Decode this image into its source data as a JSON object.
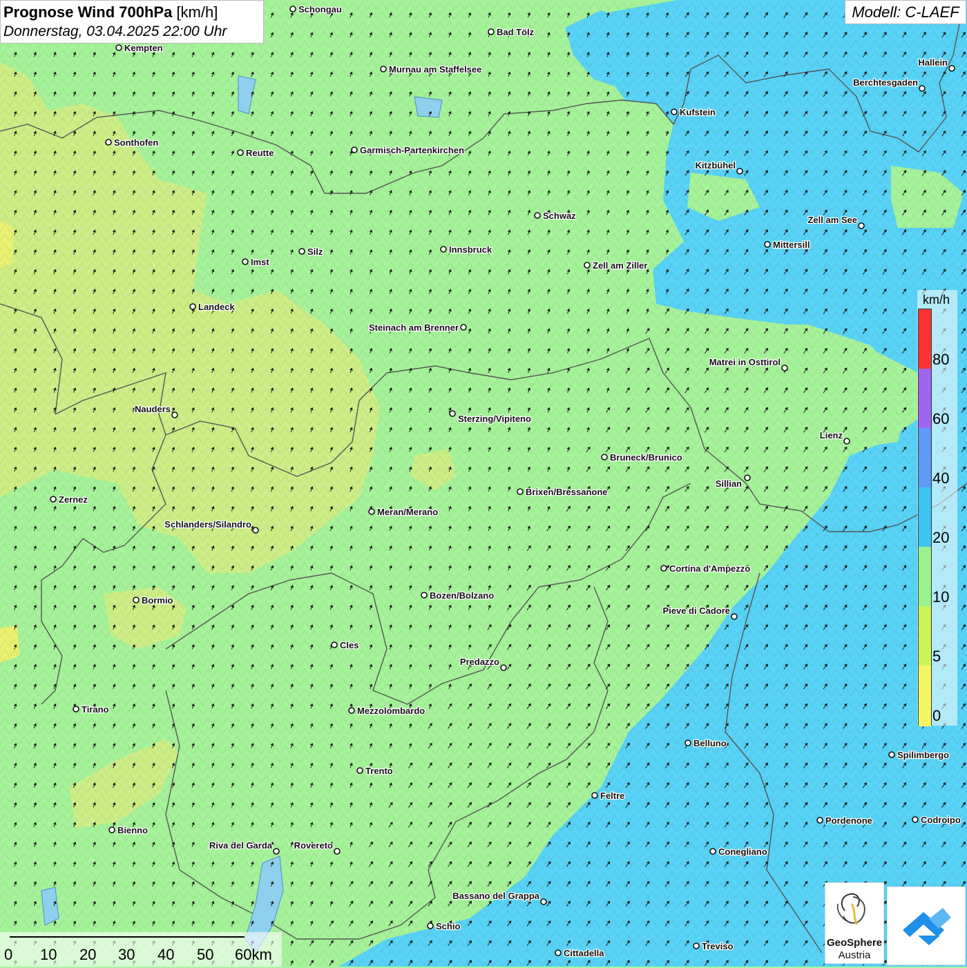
{
  "title": {
    "main": "Prognose Wind 700hPa",
    "unit": "[km/h]",
    "datetime": "Donnerstag, 03.04.2025 22:00 Uhr"
  },
  "model": "Modell: C-LAEF",
  "legend": {
    "unit": "km/h",
    "labels": [
      "80",
      "60",
      "40",
      "20",
      "10",
      "5",
      "0"
    ],
    "colors": {
      "c80": "#fa3434",
      "c60": "#9e66f0",
      "c40": "#5e9af8",
      "c20": "#3ec4f4",
      "c10": "#9af28e",
      "c5": "#cdf55a",
      "c0": "#f5f564"
    }
  },
  "scale": {
    "labels": [
      "0",
      "10",
      "20",
      "30",
      "40",
      "50",
      "60km"
    ]
  },
  "places": [
    "Schongau",
    "Bad Tölz",
    "Kempten",
    "Murnau am Staffelsee",
    "Hallein",
    "Berchtesgaden",
    "Kufstein",
    "Sonthofen",
    "Reutte",
    "Garmisch-Partenkirchen",
    "Kitzbühel",
    "Schwaz",
    "Zell am See",
    "Mittersill",
    "Imst",
    "Silz",
    "Innsbruck",
    "Zell am Ziller",
    "Landeck",
    "Steinach am Brenner",
    "Matrei in Osttirol",
    "Nauders",
    "Sterzing/Vipiteno",
    "Lienz",
    "Bruneck/Brunico",
    "Sillian",
    "Zernez",
    "Brixen/Bressanone",
    "Meran/Merano",
    "Schlanders/Silandro",
    "Cortina d'Ampezzo",
    "Bozen/Bolzano",
    "Bormio",
    "Pieve di Cadore",
    "Cles",
    "Predazzo",
    "Tirano",
    "Mezzolombardo",
    "Belluno",
    "Spilimbergo",
    "Trento",
    "Feltre",
    "Pordenone",
    "Codroipo",
    "Bienno",
    "Riva del Garda",
    "Rovereto",
    "Conegliano",
    "Bassano del Grappa",
    "Schio",
    "Treviso",
    "Cittadella"
  ],
  "logos": {
    "geosphere_line1": "GeoSphere",
    "geosphere_line2": "Austria"
  }
}
